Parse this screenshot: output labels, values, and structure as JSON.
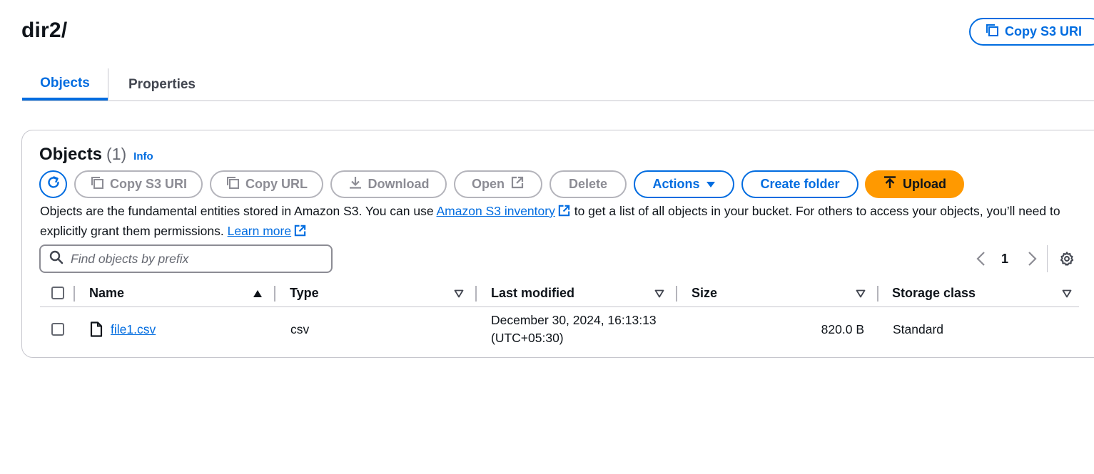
{
  "page": {
    "title": "dir2/",
    "copy_s3_uri_label": "Copy S3 URI"
  },
  "tabs": [
    {
      "label": "Objects",
      "active": true
    },
    {
      "label": "Properties",
      "active": false
    }
  ],
  "objects_panel": {
    "title": "Objects",
    "count": "(1)",
    "info_label": "Info",
    "toolbar": {
      "copy_s3_uri": "Copy S3 URI",
      "copy_url": "Copy URL",
      "download": "Download",
      "open": "Open",
      "delete": "Delete",
      "actions": "Actions",
      "create_folder": "Create folder",
      "upload": "Upload"
    },
    "description": {
      "part1": "Objects are the fundamental entities stored in Amazon S3. You can use ",
      "link1": "Amazon S3 inventory",
      "part2": " to get a list of all objects in your bucket. For others to access your objects, you’ll need to explicitly grant them permissions. ",
      "link2": "Learn more"
    },
    "search": {
      "placeholder": "Find objects by prefix",
      "value": ""
    },
    "pagination": {
      "current_page": "1"
    },
    "table": {
      "columns": [
        "Name",
        "Type",
        "Last modified",
        "Size",
        "Storage class"
      ],
      "rows": [
        {
          "name": "file1.csv",
          "type": "csv",
          "last_modified_line1": "December 30, 2024, 16:13:13",
          "last_modified_line2": "(UTC+05:30)",
          "size": "820.0 B",
          "storage_class": "Standard"
        }
      ]
    }
  },
  "colors": {
    "accent": "#006ce0",
    "upload": "#ff9900",
    "disabled": "#8c8c94",
    "border": "#c6c6cd"
  },
  "icons": [
    "copy-icon",
    "refresh-icon",
    "download-icon",
    "external-link-icon",
    "caret-down-icon",
    "upload-arrow-icon",
    "search-icon",
    "chevron-left-icon",
    "chevron-right-icon",
    "gear-icon",
    "sort-ascending-icon",
    "sort-descending-icon",
    "file-icon"
  ]
}
